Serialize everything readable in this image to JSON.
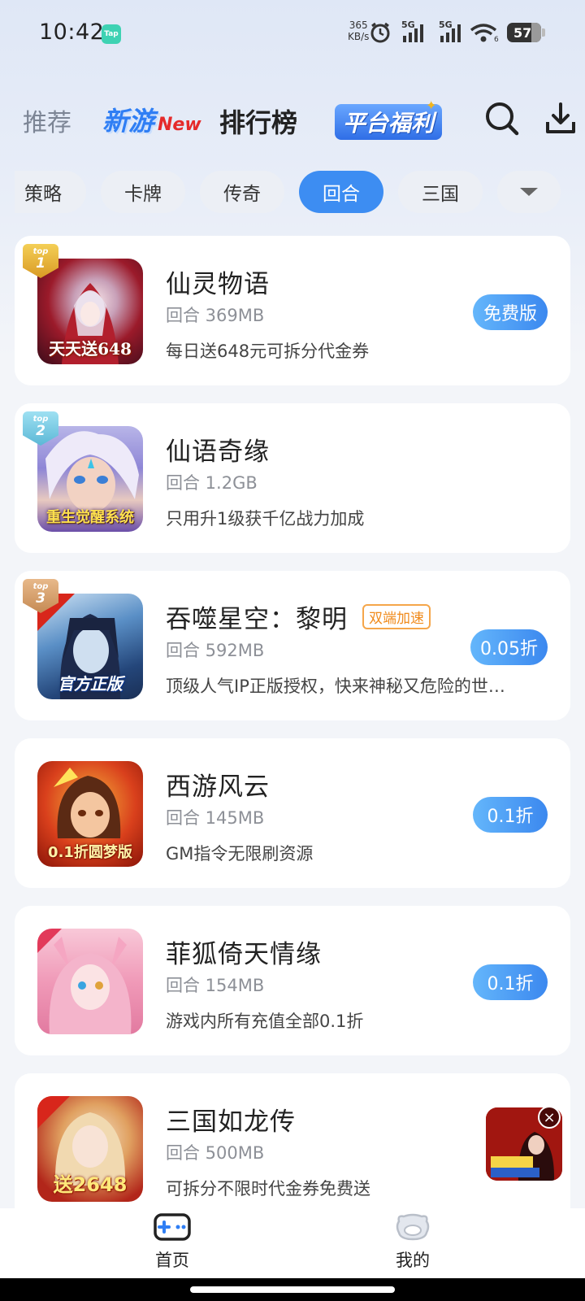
{
  "status_bar": {
    "time": "10:42",
    "app_badge": "Tap",
    "net_speed_value": "365",
    "net_speed_unit": "KB/s",
    "signal_1": "5G",
    "signal_2": "5G",
    "wifi_label": "6",
    "battery": "57"
  },
  "top_nav": {
    "tabs": [
      {
        "label": "推荐"
      },
      {
        "label": "新游",
        "suffix": "New"
      },
      {
        "label": "排行榜"
      },
      {
        "label": "平台福利"
      }
    ],
    "active_index": 2
  },
  "categories": {
    "items": [
      "策略",
      "卡牌",
      "传奇",
      "回合",
      "三国"
    ],
    "active_index": 3
  },
  "games": [
    {
      "rank": "1",
      "rank_label": "top",
      "name": "仙灵物语",
      "meta": "回合 369MB",
      "desc": "每日送648元可拆分代金券",
      "action": "免费版",
      "icon_caption": "天天送648",
      "tag": ""
    },
    {
      "rank": "2",
      "rank_label": "top",
      "name": "仙语奇缘",
      "meta": "回合 1.2GB",
      "desc": "只用升1级获千亿战力加成",
      "action": "",
      "icon_caption": "重生觉醒系统",
      "tag": ""
    },
    {
      "rank": "3",
      "rank_label": "top",
      "name": "吞噬星空：黎明",
      "meta": "回合 592MB",
      "desc": "顶级人气IP正版授权，快来神秘又危险的世…",
      "action": "0.05折",
      "icon_caption": "官方正版",
      "tag": "双端加速"
    },
    {
      "rank": "",
      "rank_label": "",
      "name": "西游风云",
      "meta": "回合 145MB",
      "desc": "GM指令无限刷资源",
      "action": "0.1折",
      "icon_caption": "0.1折圆梦版",
      "tag": ""
    },
    {
      "rank": "",
      "rank_label": "",
      "name": "菲狐倚天情缘",
      "meta": "回合 154MB",
      "desc": "游戏内所有充值全部0.1折",
      "action": "0.1折",
      "icon_caption": "",
      "tag": ""
    },
    {
      "rank": "",
      "rank_label": "",
      "name": "三国如龙传",
      "meta": "回合 500MB",
      "desc": "可拆分不限时代金券免费送",
      "action": "",
      "icon_caption": "送2648",
      "tag": ""
    }
  ],
  "bottom_nav": {
    "home": "首页",
    "mine": "我的"
  },
  "colors": {
    "accent": "#3d8df2",
    "badge_gold": "#e8b93a",
    "badge_teal": "#7fd0e6",
    "badge_bronze": "#d7a068",
    "tag_orange": "#f08b1c"
  }
}
